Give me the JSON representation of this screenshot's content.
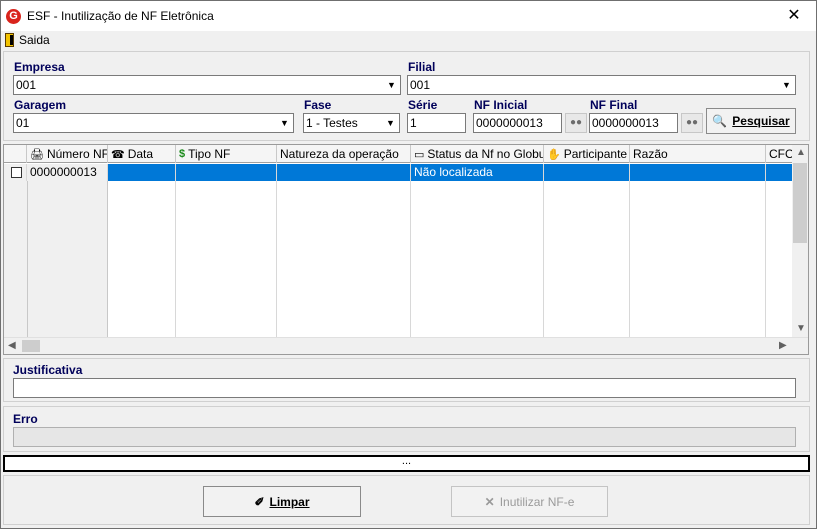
{
  "window": {
    "title": "ESF - Inutilização de NF Eletrônica",
    "app_icon": "G"
  },
  "menu": {
    "saida": "Saida"
  },
  "filters": {
    "empresa_label": "Empresa",
    "empresa_value": "001",
    "filial_label": "Filial",
    "filial_value": "001",
    "garagem_label": "Garagem",
    "garagem_value": "01",
    "fase_label": "Fase",
    "fase_value": "1 - Testes",
    "serie_label": "Série",
    "serie_value": "1",
    "nf_inicial_label": "NF Inicial",
    "nf_inicial_value": "0000000013",
    "nf_final_label": "NF Final",
    "nf_final_value": "0000000013",
    "pesquisar_label": "Pesquisar"
  },
  "grid": {
    "columns": [
      "Número NF",
      "Data",
      "Tipo NF",
      "Natureza da operação",
      "Status da Nf no Globus",
      "Participante",
      "Razão",
      "CFOP"
    ],
    "rows": [
      {
        "numero_nf": "0000000013",
        "data": "",
        "tipo_nf": "",
        "natureza": "",
        "status": "Não localizada",
        "participante": "",
        "razao": "",
        "cfop": ""
      }
    ]
  },
  "justificativa": {
    "label": "Justificativa",
    "value": ""
  },
  "erro": {
    "label": "Erro",
    "value": ""
  },
  "status": {
    "text": "..."
  },
  "buttons": {
    "limpar": "Limpar",
    "inutilizar": "Inutilizar NF-e"
  }
}
